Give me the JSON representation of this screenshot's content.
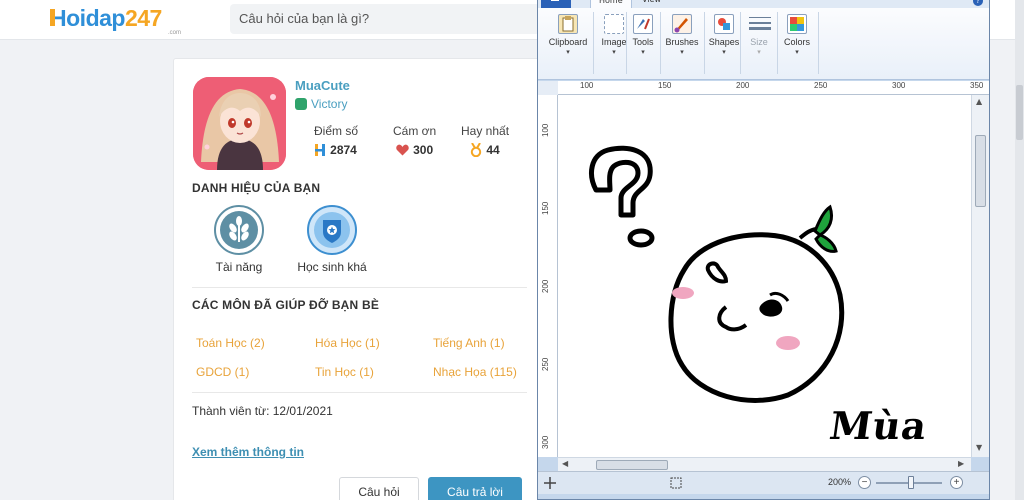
{
  "site": {
    "logo": {
      "h": "H",
      "text": "oidap",
      "num": "247",
      "com": ".com"
    },
    "search_placeholder": "Câu hỏi của bạn là gì?"
  },
  "profile": {
    "name": "MuaCute",
    "rank": "Victory",
    "stats": [
      {
        "label": "Điểm số",
        "value": "2874",
        "icon": "h-points-icon"
      },
      {
        "label": "Cám ơn",
        "value": "300",
        "icon": "heart-icon"
      },
      {
        "label": "Hay nhất",
        "value": "44",
        "icon": "medal-icon"
      }
    ],
    "titles_heading": "DANH HIỆU CỦA BẠN",
    "badges": [
      {
        "label": "Tài năng",
        "icon": "wheat-icon"
      },
      {
        "label": "Học sinh khá",
        "icon": "shield-star-icon"
      }
    ],
    "subjects_heading": "CÁC MÔN ĐÃ GIÚP ĐỠ BẠN BÈ",
    "subjects": [
      "Toán Học (2)",
      "Hóa Học (1)",
      "Tiếng Anh (1)",
      "GDCD (1)",
      "Tin Học (1)",
      "Nhạc Họa (115)"
    ],
    "member_since": "Thành viên từ: 12/01/2021",
    "more_link": "Xem thêm thông tin",
    "ask_button": "Câu hỏi",
    "answer_button": "Câu trả lời"
  },
  "paint": {
    "tabs": [
      "Home",
      "View"
    ],
    "groups": [
      {
        "label": "Clipboard",
        "icon": "clipboard-icon",
        "disabled": false
      },
      {
        "label": "Image",
        "icon": "image-select-icon",
        "disabled": false
      },
      {
        "label": "Tools",
        "icon": "tools-icon",
        "disabled": false
      },
      {
        "label": "Brushes",
        "icon": "brush-icon",
        "disabled": false
      },
      {
        "label": "Shapes",
        "icon": "shapes-icon",
        "disabled": false
      },
      {
        "label": "Size",
        "icon": "size-icon",
        "disabled": true
      },
      {
        "label": "Colors",
        "icon": "colors-icon",
        "disabled": false
      }
    ],
    "ruler_top": [
      "100",
      "150",
      "200",
      "250",
      "300",
      "350"
    ],
    "ruler_left": [
      "100",
      "150",
      "200",
      "250",
      "300"
    ],
    "canvas_text": "Mùa",
    "zoom": "200%"
  },
  "colors": {
    "site_blue": "#2f8fd8",
    "site_orange": "#f5a623",
    "name_blue": "#4a9fc0",
    "subject_orange": "#e8a33a",
    "answer_button": "#3d95c2",
    "avatar_bg": "#ee5e75",
    "leaf_green": "#1fa33c",
    "blush_pink": "#f0a6c0"
  }
}
